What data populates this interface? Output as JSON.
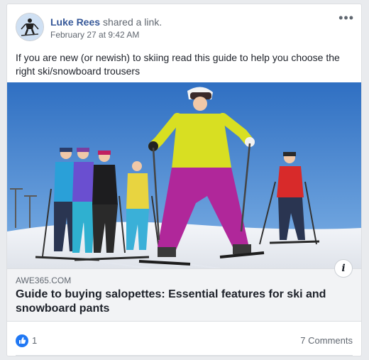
{
  "post": {
    "author": "Luke Rees",
    "action": "shared a link.",
    "timestamp": "February 27 at 9:42 AM",
    "more_icon": "more-horizontal-icon",
    "text": "If you are new (or newish) to skiing read this guide to help you choose the right ski/snowboard trousers"
  },
  "link": {
    "domain": "AWE365.COM",
    "title": "Guide to buying salopettes: Essential features for ski and snowboard pants",
    "info_icon": "info-icon"
  },
  "footer": {
    "reaction_icon": "thumbs-up-icon",
    "like_count": "1",
    "comments": "7 Comments"
  },
  "colors": {
    "link_blue": "#365899",
    "like_blue": "#2078f4",
    "jacket_yellow": "#d8df22",
    "pants_magenta": "#b0279a",
    "sky": "#3a7bc8"
  }
}
